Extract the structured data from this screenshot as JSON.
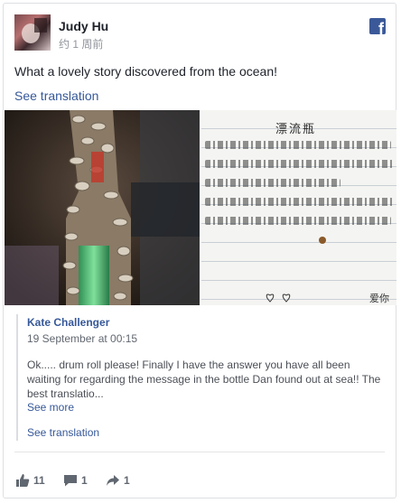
{
  "post": {
    "author": "Judy Hu",
    "time": "约 1 周前",
    "text": "What a lovely story discovered from the ocean!",
    "see_translation": "See translation"
  },
  "photos": {
    "letter_title": "漂流瓶",
    "letter_lines": [
      "一名渔民，现在正在印度洋上正在航行，心里很思念",
      "一别已经不久就会找出海了，心里总觉得不知道",
      "家里有瓶把心事托付给我。",
      "希望我的事，能在远方被人看到，某某某",
      "也希望有人能捡到打开，只是我一个人心里的念想。"
    ],
    "letter_signoff": "爱你"
  },
  "shared": {
    "author": "Kate Challenger",
    "date": "19 September at 00:15",
    "text": "Ok..... drum roll please! Finally I have the answer you have all been waiting for regarding the message in the bottle Dan found out at sea!! The best translatio...",
    "see_more": "See more",
    "see_translation": "See translation"
  },
  "actions": {
    "likes": "11",
    "comments": "1",
    "shares": "1"
  },
  "colors": {
    "link": "#365899",
    "facebook_blue": "#3b5998",
    "meta_gray": "#90949c"
  },
  "icons": [
    "facebook-logo-icon",
    "like-icon",
    "comment-icon",
    "share-icon"
  ]
}
